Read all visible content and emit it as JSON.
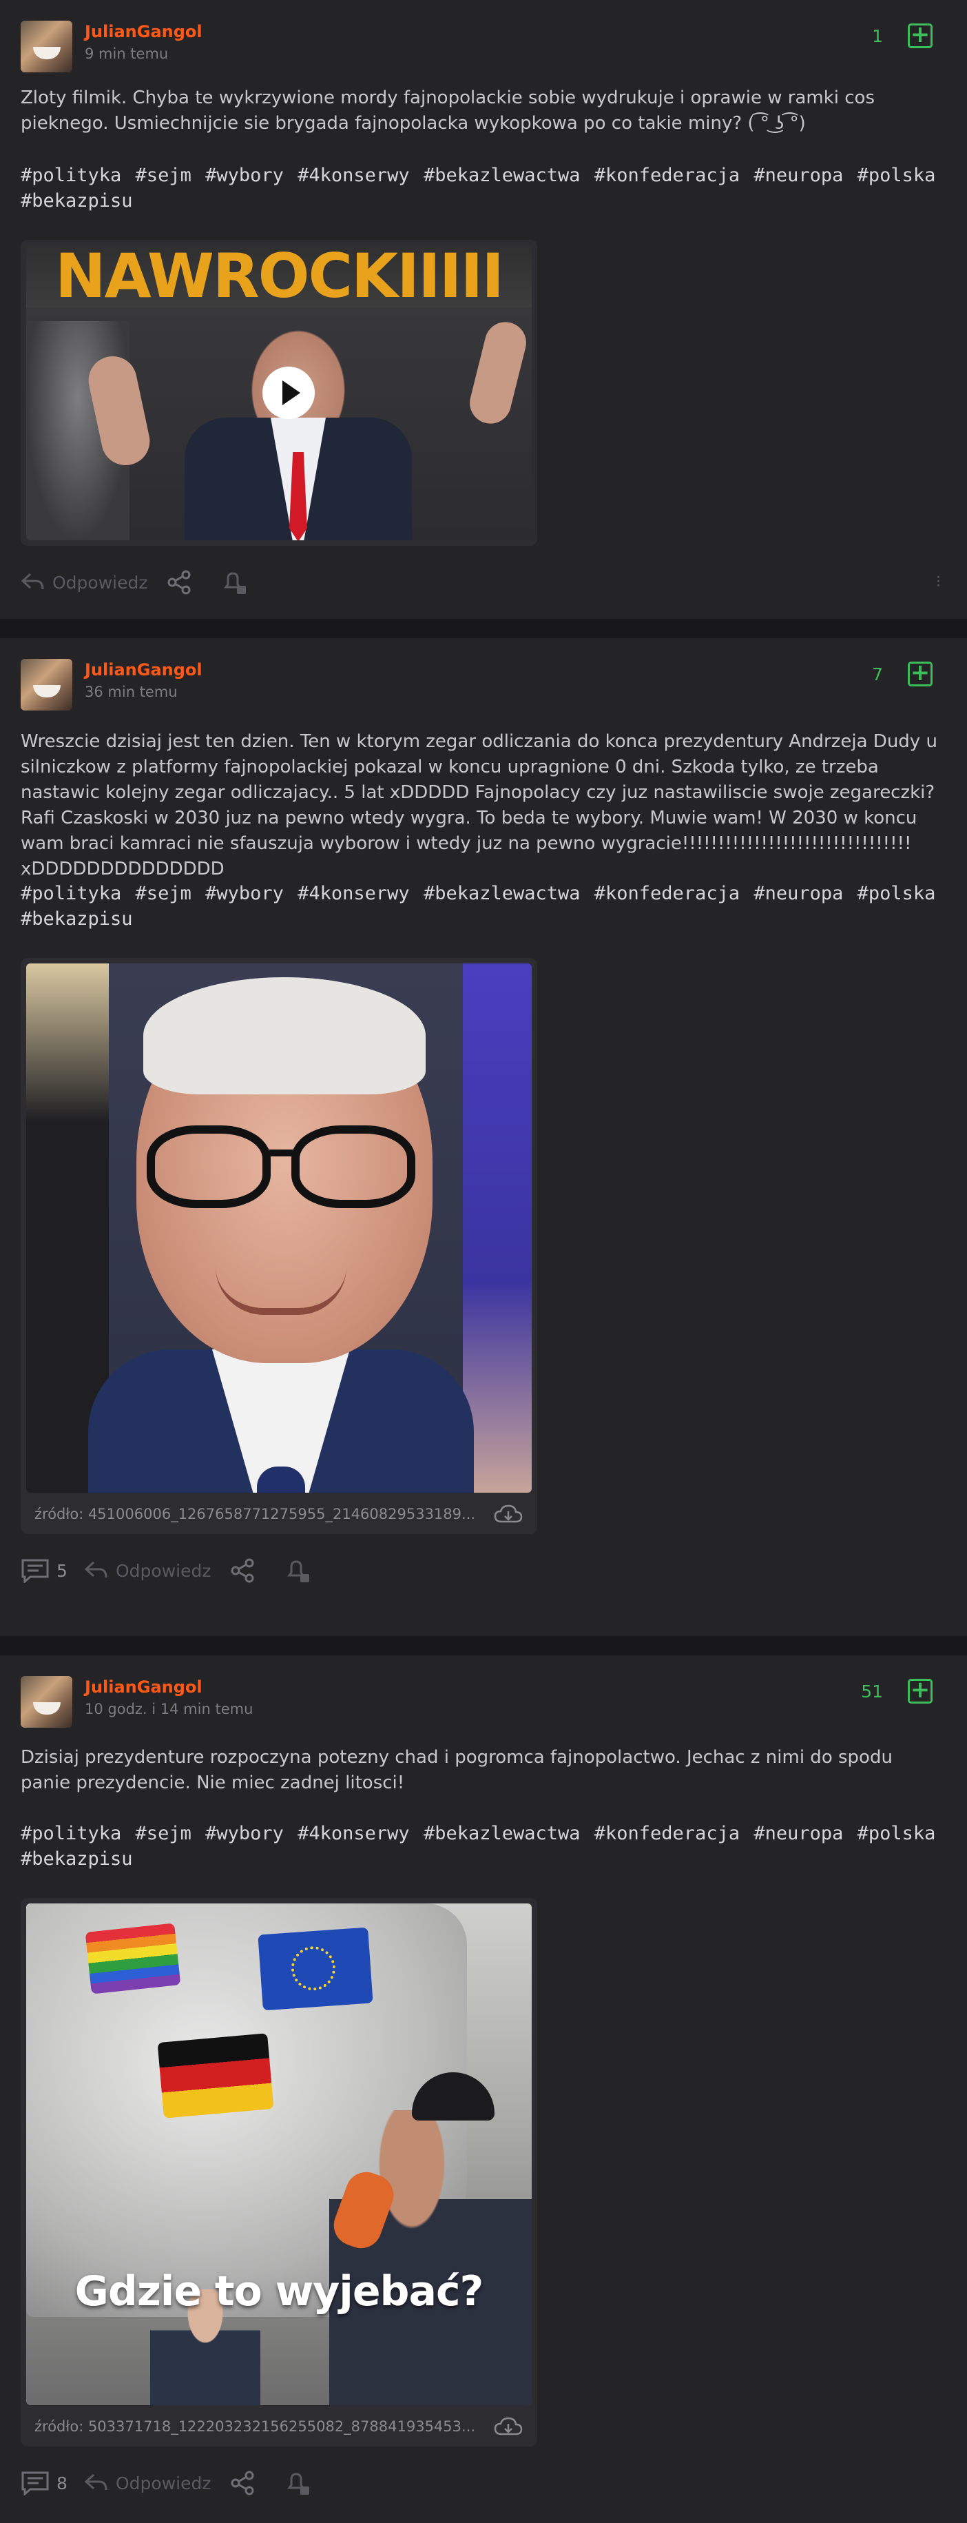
{
  "posts": [
    {
      "username": "JulianGangol",
      "time": "9 min temu",
      "votes": "1",
      "plus": "+",
      "text": "Zloty filmik. Chyba te wykrzywione mordy fajnopolackie sobie wydrukuje i oprawie w ramki cos pieknego. Usmiechnijcie sie brygada fajnopolacka wykopkowa po co takie miny? ( ͡° ͜ʖ ͡°)",
      "tags": "#polityka #sejm #wybory #4konserwy #bekazlewactwa #konfederacja #neuropa #polska #bekazpisu",
      "media_banner": "NAWROCKIIIII",
      "reply_label": "Odpowiedz"
    },
    {
      "username": "JulianGangol",
      "time": "36 min temu",
      "votes": "7",
      "plus": "+",
      "text": "Wreszcie dzisiaj jest ten dzien. Ten w ktorym zegar odliczania do konca prezydentury Andrzeja Dudy u silniczkow z platformy fajnopolackiej pokazal w koncu upragnione 0 dni. Szkoda tylko, ze trzeba nastawic kolejny zegar odliczajacy.. 5 lat xDDDDD Fajnopolacy czy juz nastawiliscie swoje zegareczki? Rafi Czaskoski w 2030 juz na pewno wtedy wygra. To beda te wybory. Muwie wam! W 2030 w koncu wam braci kamraci nie sfauszuja wyborow i wtedy juz na pewno wygracie!!!!!!!!!!!!!!!!!!!!!!!!!!!!!!!! xDDDDDDDDDDDDDD",
      "tags": "#polityka #sejm #wybory #4konserwy #bekazlewactwa #konfederacja #neuropa #polska #bekazpisu",
      "source": "źródło: 451006006_1267658771275955_21460829533189...",
      "comments": "5",
      "reply_label": "Odpowiedz"
    },
    {
      "username": "JulianGangol",
      "time": "10 godz. i 14 min temu",
      "votes": "51",
      "plus": "+",
      "text": "Dzisiaj prezydenture rozpoczyna potezny chad i pogromca fajnopolactwo. Jechac z nimi do spodu panie prezydencie. Nie miec zadnej litosci!",
      "tags": "#polityka #sejm #wybory #4konserwy #bekazlewactwa #konfederacja #neuropa #polska #bekazpisu",
      "media_caption": "Gdzie to wyjebać?",
      "source": "źródło: 503371718_122203232156255082_878841935453...",
      "comments": "8",
      "reply_label": "Odpowiedz"
    }
  ],
  "colors": {
    "background": "#1b1b1d",
    "card": "#242427",
    "username": "#ff5917",
    "vote_green": "#3cbf5a"
  },
  "icons": [
    "comment-icon",
    "reply-icon",
    "share-icon",
    "notify-icon",
    "download-icon",
    "play-icon"
  ]
}
